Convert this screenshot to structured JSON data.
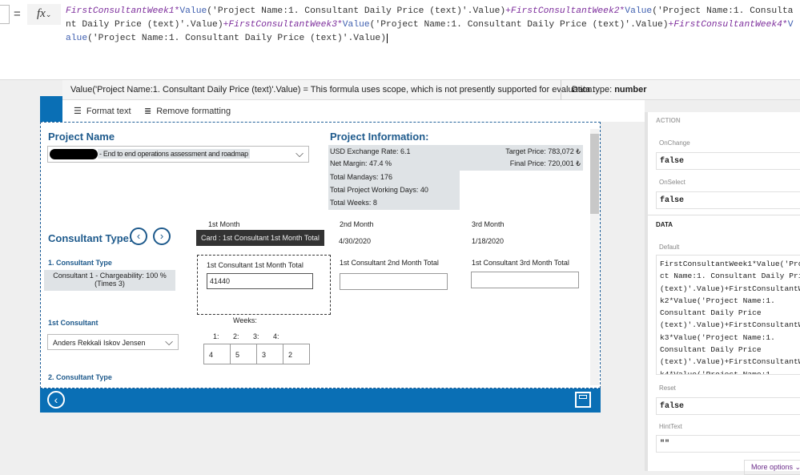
{
  "formula_bar": {
    "equals": "=",
    "fx": "fx",
    "fx_caret": "⌄",
    "segments": [
      {
        "t": "FirstConsultantWeek1",
        "k": "id"
      },
      {
        "t": "*",
        "k": "op"
      },
      {
        "t": "Value",
        "k": "fn"
      },
      {
        "t": "('Project Name:1. Consultant Daily Price (text)'.Value)",
        "k": "s"
      },
      {
        "t": "+",
        "k": "op"
      },
      {
        "t": "FirstConsultantWeek2",
        "k": "id"
      },
      {
        "t": "*",
        "k": "op"
      },
      {
        "t": "Value",
        "k": "fn"
      },
      {
        "t": "('Project Name:1. Consultant Daily Price (text)'.Value)",
        "k": "s"
      },
      {
        "t": "+",
        "k": "op"
      },
      {
        "t": "FirstConsultantWeek3",
        "k": "id"
      },
      {
        "t": "*",
        "k": "op"
      },
      {
        "t": "Value",
        "k": "fn"
      },
      {
        "t": "('Project Name:1. Consultant Daily Price (text)'.Value)",
        "k": "s"
      },
      {
        "t": "+",
        "k": "op"
      },
      {
        "t": "FirstConsultantWeek4",
        "k": "id"
      },
      {
        "t": "*",
        "k": "op"
      },
      {
        "t": "Value",
        "k": "fn"
      },
      {
        "t": "('Project Name:1. Consultant Daily Price (text)'.Value)",
        "k": "s"
      }
    ]
  },
  "eval": {
    "message": "Value('Project Name:1. Consultant Daily Price (text)'.Value)  =  This formula uses scope, which is not presently supported for evaluation.",
    "data_type_label": "Data type:",
    "data_type": "number"
  },
  "toolbar": {
    "format_text": "Format text",
    "remove_formatting": "Remove formatting"
  },
  "app": {
    "project_name_title": "Project Name",
    "project_selected": "- End to end operations assessment and roadmap",
    "info_title": "Project Information:",
    "usd_rate": "USD Exchange Rate: 6.1",
    "target_price": "Target Price: 783,072 ₺",
    "net_margin": "Net Margin: 47.4 %",
    "final_price": "Final Price: 720,001 ₺",
    "total_mandays": "Total Mandays: 176",
    "total_working_days": "Total Project Working Days: 40",
    "total_weeks": "Total Weeks: 8",
    "consultant_type_title": "Consultant Type:",
    "month1": "1st Month",
    "month2": "2nd Month",
    "month3": "3rd Month",
    "date2": "4/30/2020",
    "date3": "1/18/2020",
    "tooltip": "Card : 1st Consultant 1st Month Total",
    "ct1_label": "1. Consultant Type",
    "ct1_value_line1": "Consultant 1 - Chargeability: 100 %",
    "ct1_value_line2": "(Times 3)",
    "m1_total_label": "1st Consultant 1st Month Total",
    "m1_total_value": "41440",
    "m2_total_label": "1st Consultant 2nd Month Total",
    "m3_total_label": "1st Consultant 3rd Month Total",
    "consultant1_label": "1st Consultant",
    "consultant1_value": "Anders Rekkali Iskov Jensen",
    "weeks_label": "Weeks:",
    "week_headers": [
      "1:",
      "2:",
      "3:",
      "4:"
    ],
    "week_values": [
      "4",
      "5",
      "3",
      "2"
    ],
    "ct2_label": "2. Consultant Type"
  },
  "right_panel": {
    "section_action": "ACTION",
    "onchange_label": "OnChange",
    "onchange": "false",
    "onselect_label": "OnSelect",
    "onselect": "false",
    "section_data": "DATA",
    "default_label": "Default",
    "default_lines": [
      "FirstConsultantWeek1*Value('Proje",
      "ct Name:1. Consultant Daily Price",
      "(text)'.Value)+FirstConsultantWee",
      "k2*Value('Project Name:1.",
      "Consultant Daily Price",
      "(text)'.Value)+FirstConsultantWee",
      "k3*Value('Project Name:1.",
      "Consultant Daily Price",
      "(text)'.Value)+FirstConsultantWee",
      "k4*Value('Project Name:1"
    ],
    "reset_label": "Reset",
    "reset": "false",
    "hinttext_label": "HintText",
    "hinttext": "\"\"",
    "more_options": "More options ⌄"
  },
  "colors": {
    "brand_blue": "#0a6fb5",
    "heading_blue": "#1e5a8c",
    "formula_identifier": "#7d2e9c"
  }
}
